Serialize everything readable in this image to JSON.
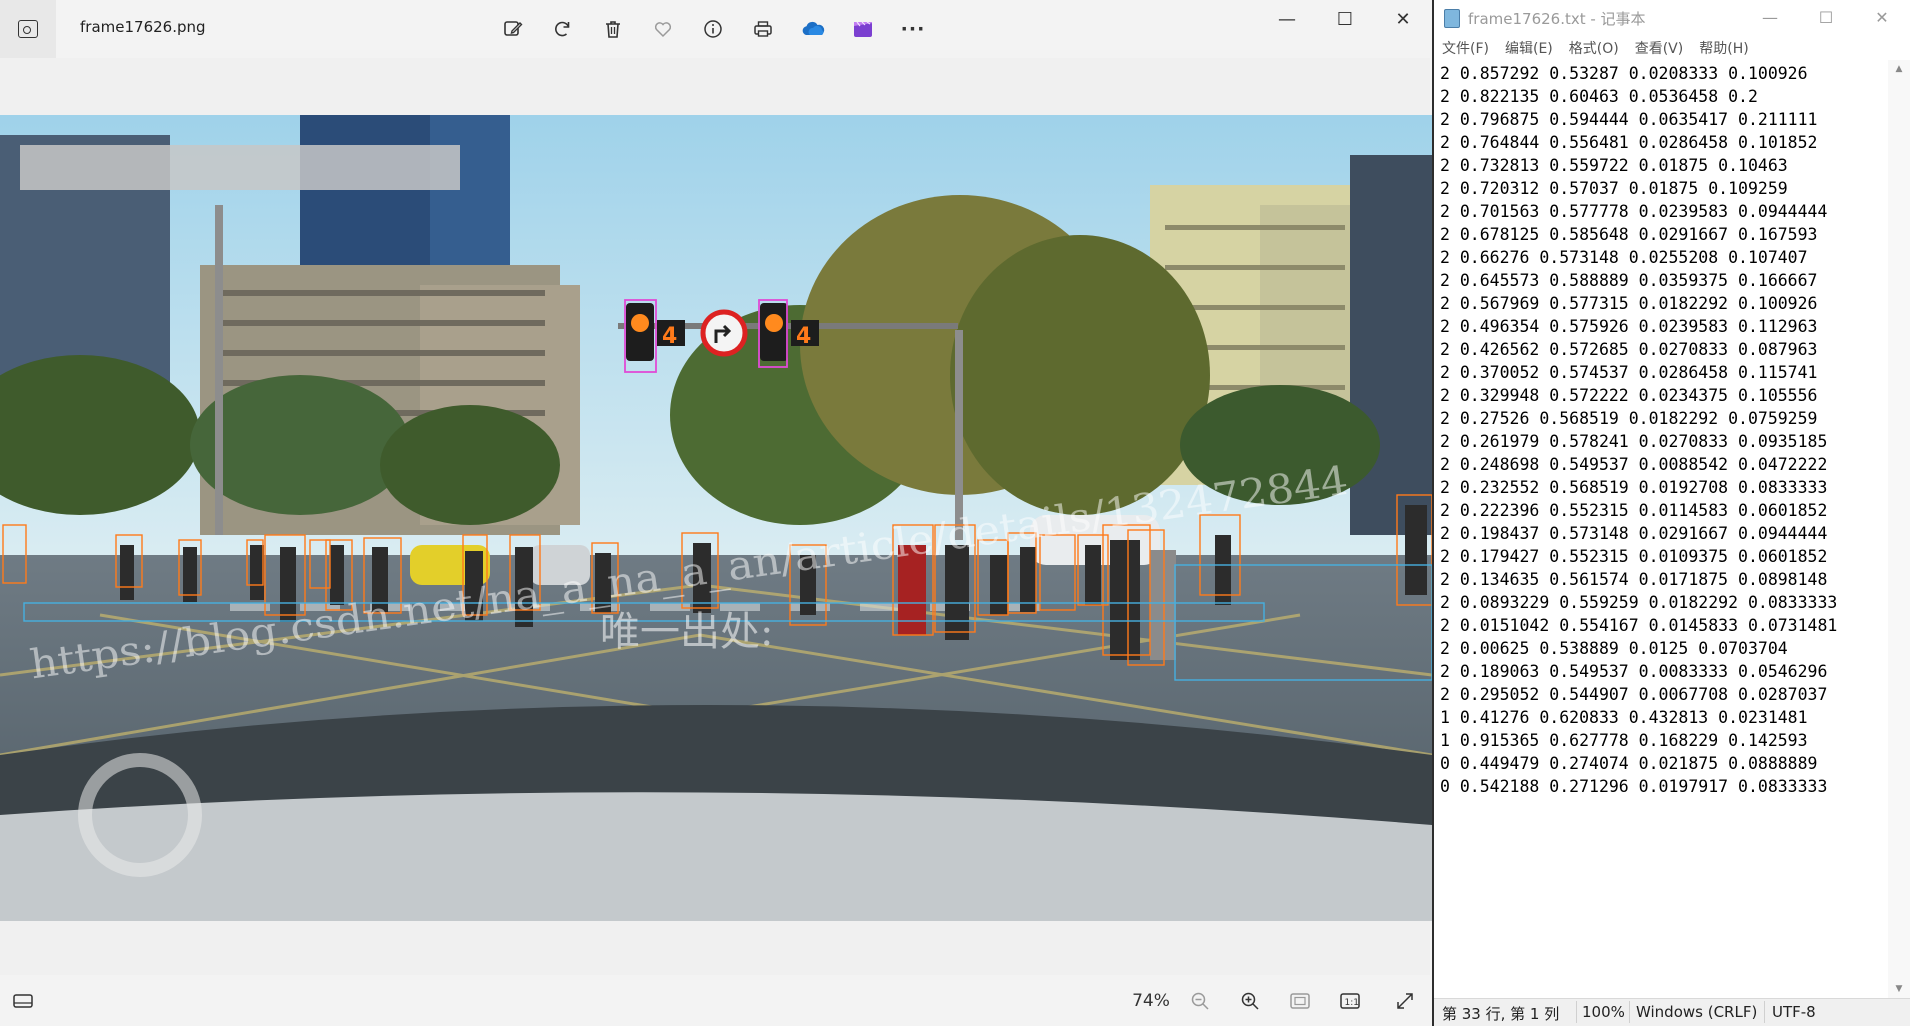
{
  "photos": {
    "filename": "frame17626.png",
    "toolbar": {
      "edit": "edit-image-icon",
      "rotate": "rotate-icon",
      "delete": "delete-icon",
      "favorite": "heart-icon",
      "info": "info-icon",
      "print": "print-icon",
      "onedrive": "cloud-icon",
      "clipchamp": "video-editor-icon",
      "more_label": "···"
    },
    "window_controls": {
      "minimize": "—",
      "maximize": "☐",
      "close": "✕"
    },
    "watermark": "唯一出处:",
    "watermark_url": "https://blog.csdn.net/na_a_na_a_an/article/details/132472844",
    "signs": {
      "countdown": "4"
    },
    "bottom": {
      "zoom_label": "74%"
    },
    "colors": {
      "pedestrian_box": "#ff7a1a",
      "traffic_light_box": "#e04bd6",
      "crosswalk_box": "#46b0e0"
    }
  },
  "notepad": {
    "title": "frame17626.txt - 记事本",
    "menu": [
      "文件(F)",
      "编辑(E)",
      "格式(O)",
      "查看(V)",
      "帮助(H)"
    ],
    "lines": [
      "2 0.857292 0.53287 0.0208333 0.100926",
      "2 0.822135 0.60463 0.0536458 0.2",
      "2 0.796875 0.594444 0.0635417 0.211111",
      "2 0.764844 0.556481 0.0286458 0.101852",
      "2 0.732813 0.559722 0.01875 0.10463",
      "2 0.720312 0.57037 0.01875 0.109259",
      "2 0.701563 0.577778 0.0239583 0.0944444",
      "2 0.678125 0.585648 0.0291667 0.167593",
      "2 0.66276 0.573148 0.0255208 0.107407",
      "2 0.645573 0.588889 0.0359375 0.166667",
      "2 0.567969 0.577315 0.0182292 0.100926",
      "2 0.496354 0.575926 0.0239583 0.112963",
      "2 0.426562 0.572685 0.0270833 0.087963",
      "2 0.370052 0.574537 0.0286458 0.115741",
      "2 0.329948 0.572222 0.0234375 0.105556",
      "2 0.27526 0.568519 0.0182292 0.0759259",
      "2 0.261979 0.578241 0.0270833 0.0935185",
      "2 0.248698 0.549537 0.0088542 0.0472222",
      "2 0.232552 0.568519 0.0192708 0.0833333",
      "2 0.222396 0.552315 0.0114583 0.0601852",
      "2 0.198437 0.573148 0.0291667 0.0944444",
      "2 0.179427 0.552315 0.0109375 0.0601852",
      "2 0.134635 0.561574 0.0171875 0.0898148",
      "2 0.0893229 0.559259 0.0182292 0.0833333",
      "2 0.0151042 0.554167 0.0145833 0.0731481",
      "2 0.00625 0.538889 0.0125 0.0703704",
      "2 0.189063 0.549537 0.0083333 0.0546296",
      "2 0.295052 0.544907 0.0067708 0.0287037",
      "1 0.41276 0.620833 0.432813 0.0231481",
      "1 0.915365 0.627778 0.168229 0.142593",
      "0 0.449479 0.274074 0.021875 0.0888889",
      "0 0.542188 0.271296 0.0197917 0.0833333"
    ],
    "status": {
      "position": "第 33 行, 第 1 列",
      "zoom": "100%",
      "line_ending": "Windows (CRLF)",
      "encoding": "UTF-8"
    }
  }
}
